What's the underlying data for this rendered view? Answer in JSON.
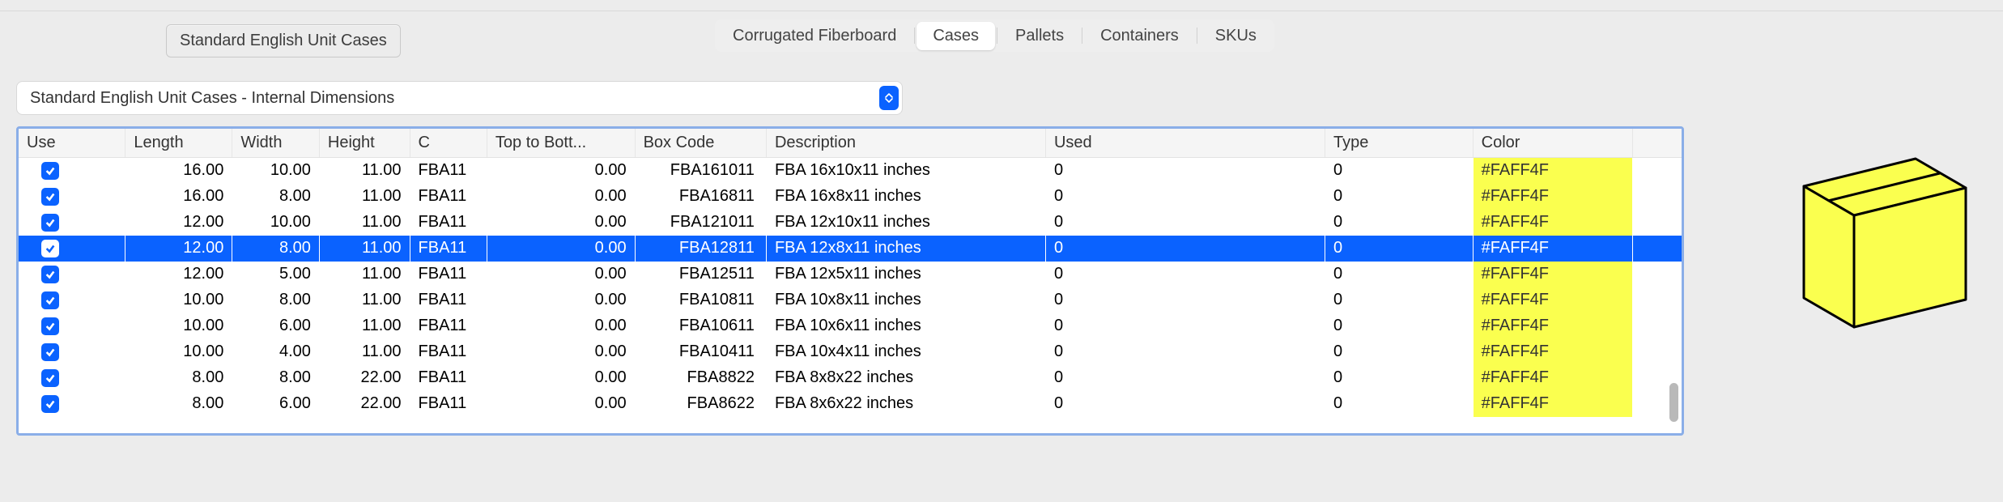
{
  "chip_label": "Standard English Unit Cases",
  "tabs": {
    "items": [
      "Corrugated Fiberboard",
      "Cases",
      "Pallets",
      "Containers",
      "SKUs"
    ],
    "active_index": 1
  },
  "dropdown": {
    "label": "Standard English Unit Cases - Internal Dimensions"
  },
  "columns": {
    "use": "Use",
    "length": "Length",
    "width": "Width",
    "height": "Height",
    "c": "C",
    "ttb": "Top to Bott...",
    "boxcode": "Box Code",
    "description": "Description",
    "used": "Used",
    "type": "Type",
    "color": "Color"
  },
  "rows": [
    {
      "use": true,
      "length": "16.00",
      "width": "10.00",
      "height": "11.00",
      "c": "FBA11",
      "ttb": "0.00",
      "boxcode": "FBA161011",
      "description": "FBA 16x10x11 inches",
      "used": "0",
      "type": "0",
      "color": "#FAFF4F"
    },
    {
      "use": true,
      "length": "16.00",
      "width": "8.00",
      "height": "11.00",
      "c": "FBA11",
      "ttb": "0.00",
      "boxcode": "FBA16811",
      "description": "FBA 16x8x11 inches",
      "used": "0",
      "type": "0",
      "color": "#FAFF4F"
    },
    {
      "use": true,
      "length": "12.00",
      "width": "10.00",
      "height": "11.00",
      "c": "FBA11",
      "ttb": "0.00",
      "boxcode": "FBA121011",
      "description": "FBA 12x10x11 inches",
      "used": "0",
      "type": "0",
      "color": "#FAFF4F"
    },
    {
      "use": true,
      "length": "12.00",
      "width": "8.00",
      "height": "11.00",
      "c": "FBA11",
      "ttb": "0.00",
      "boxcode": "FBA12811",
      "description": "FBA 12x8x11 inches",
      "used": "0",
      "type": "0",
      "color": "#FAFF4F",
      "selected": true
    },
    {
      "use": true,
      "length": "12.00",
      "width": "5.00",
      "height": "11.00",
      "c": "FBA11",
      "ttb": "0.00",
      "boxcode": "FBA12511",
      "description": "FBA 12x5x11 inches",
      "used": "0",
      "type": "0",
      "color": "#FAFF4F"
    },
    {
      "use": true,
      "length": "10.00",
      "width": "8.00",
      "height": "11.00",
      "c": "FBA11",
      "ttb": "0.00",
      "boxcode": "FBA10811",
      "description": "FBA 10x8x11 inches",
      "used": "0",
      "type": "0",
      "color": "#FAFF4F"
    },
    {
      "use": true,
      "length": "10.00",
      "width": "6.00",
      "height": "11.00",
      "c": "FBA11",
      "ttb": "0.00",
      "boxcode": "FBA10611",
      "description": "FBA 10x6x11 inches",
      "used": "0",
      "type": "0",
      "color": "#FAFF4F"
    },
    {
      "use": true,
      "length": "10.00",
      "width": "4.00",
      "height": "11.00",
      "c": "FBA11",
      "ttb": "0.00",
      "boxcode": "FBA10411",
      "description": "FBA 10x4x11 inches",
      "used": "0",
      "type": "0",
      "color": "#FAFF4F"
    },
    {
      "use": true,
      "length": "8.00",
      "width": "8.00",
      "height": "22.00",
      "c": "FBA11",
      "ttb": "0.00",
      "boxcode": "FBA8822",
      "description": "FBA 8x8x22 inches",
      "used": "0",
      "type": "0",
      "color": "#FAFF4F"
    },
    {
      "use": true,
      "length": "8.00",
      "width": "6.00",
      "height": "22.00",
      "c": "FBA11",
      "ttb": "0.00",
      "boxcode": "FBA8622",
      "description": "FBA 8x6x22 inches",
      "used": "0",
      "type": "0",
      "color": "#FAFF4F"
    }
  ],
  "preview_color": "#FAFF4F"
}
